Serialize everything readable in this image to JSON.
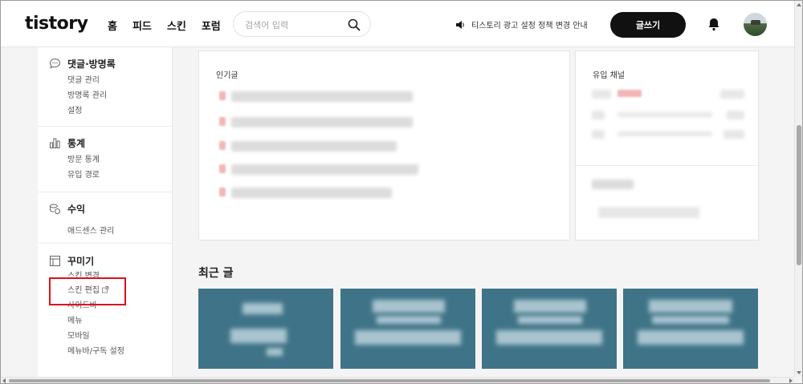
{
  "header": {
    "logo": "tistory",
    "nav": [
      "홈",
      "피드",
      "스킨",
      "포럼"
    ],
    "search_placeholder": "검색어 입력",
    "notice": "티스토리 광고 설정 정책 변경 안내",
    "write_label": "글쓰기"
  },
  "sidebar": {
    "sections": [
      {
        "title": "댓글·방명록",
        "icon": "speech-bubble-icon",
        "items": [
          "댓글 관리",
          "방명록 관리",
          "설정"
        ]
      },
      {
        "title": "통계",
        "icon": "bar-chart-icon",
        "items": [
          "방문 통계",
          "유입 경로"
        ]
      },
      {
        "title": "수익",
        "icon": "coins-icon",
        "items": [
          "애드센스 관리"
        ]
      },
      {
        "title": "꾸미기",
        "icon": "layout-icon",
        "items": [
          "스킨 변경",
          "스킨 편집",
          "사이드바",
          "메뉴",
          "모바일",
          "메뉴바/구독 설정"
        ]
      }
    ]
  },
  "main": {
    "popular_title": "인기글",
    "inflow_title": "유입 채널",
    "recent_title": "최근 글"
  },
  "colors": {
    "accent": "#111111",
    "highlight": "#e0101c",
    "thumb": "#3f7488"
  }
}
